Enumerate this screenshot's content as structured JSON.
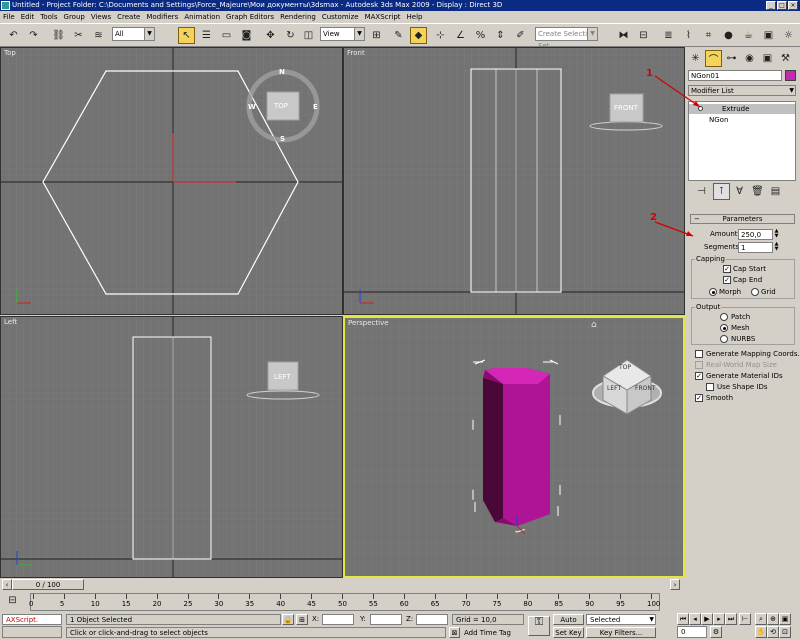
{
  "title_bar": {
    "text": "Untitled    - Project Folder: C:\\Documents and Settings\\Force_Majeure\\Мои документы\\3dsmax    - Autodesk 3ds Max  2009      - Display : Direct 3D"
  },
  "menu": [
    "File",
    "Edit",
    "Tools",
    "Group",
    "Views",
    "Create",
    "Modifiers",
    "Animation",
    "Graph Editors",
    "Rendering",
    "Customize",
    "MAXScript",
    "Help"
  ],
  "toolbar": {
    "selection_filter": "All",
    "ref_coord": "View",
    "named_selection_placeholder": "Create Selection Set"
  },
  "viewports": {
    "top": {
      "label": "Top",
      "cube": "TOP",
      "compass": {
        "n": "N",
        "e": "E",
        "w": "W",
        "s": "S"
      }
    },
    "front": {
      "label": "Front",
      "cube": "FRONT"
    },
    "left": {
      "label": "Left",
      "cube": "LEFT"
    },
    "perspective": {
      "label": "Perspective",
      "cube_faces": [
        "TOP",
        "FRONT",
        "LEFT"
      ]
    }
  },
  "command_panel": {
    "object_name": "NGon01",
    "object_color": "#c02bb0",
    "modifier_list": "Modifier List",
    "stack": [
      "Extrude",
      "NGon"
    ],
    "annotations": [
      "1",
      "2"
    ],
    "rollout_title": "Parameters",
    "amount_label": "Amount:",
    "amount_value": "250,0",
    "segments_label": "Segments:",
    "segments_value": "1",
    "capping_label": "Capping",
    "cap_start": "Cap Start",
    "cap_end": "Cap End",
    "morph": "Morph",
    "grid": "Grid",
    "output_label": "Output",
    "patch": "Patch",
    "mesh": "Mesh",
    "nurbs": "NURBS",
    "gen_mapping": "Generate Mapping Coords.",
    "real_world": "Real-World Map Size",
    "gen_matid": "Generate Material IDs",
    "use_shape_ids": "Use Shape IDs",
    "smooth": "Smooth"
  },
  "timeline": {
    "frame_display": "0 / 100",
    "ticks": [
      "0",
      "5",
      "10",
      "15",
      "20",
      "25",
      "30",
      "35",
      "40",
      "45",
      "50",
      "55",
      "60",
      "65",
      "70",
      "75",
      "80",
      "85",
      "90",
      "95",
      "100"
    ]
  },
  "status": {
    "maxscript": "AXScript.",
    "selection": "1 Object Selected",
    "prompt": "Click or click-and-drag to select objects",
    "x_label": "X:",
    "y_label": "Y:",
    "z_label": "Z:",
    "grid": "Grid = 10,0",
    "add_time_tag": "Add Time Tag",
    "auto_key": "Auto Key",
    "set_key": "Set Key",
    "key_mode": "Selected",
    "key_filters": "Key Filters...",
    "frame": "0"
  }
}
